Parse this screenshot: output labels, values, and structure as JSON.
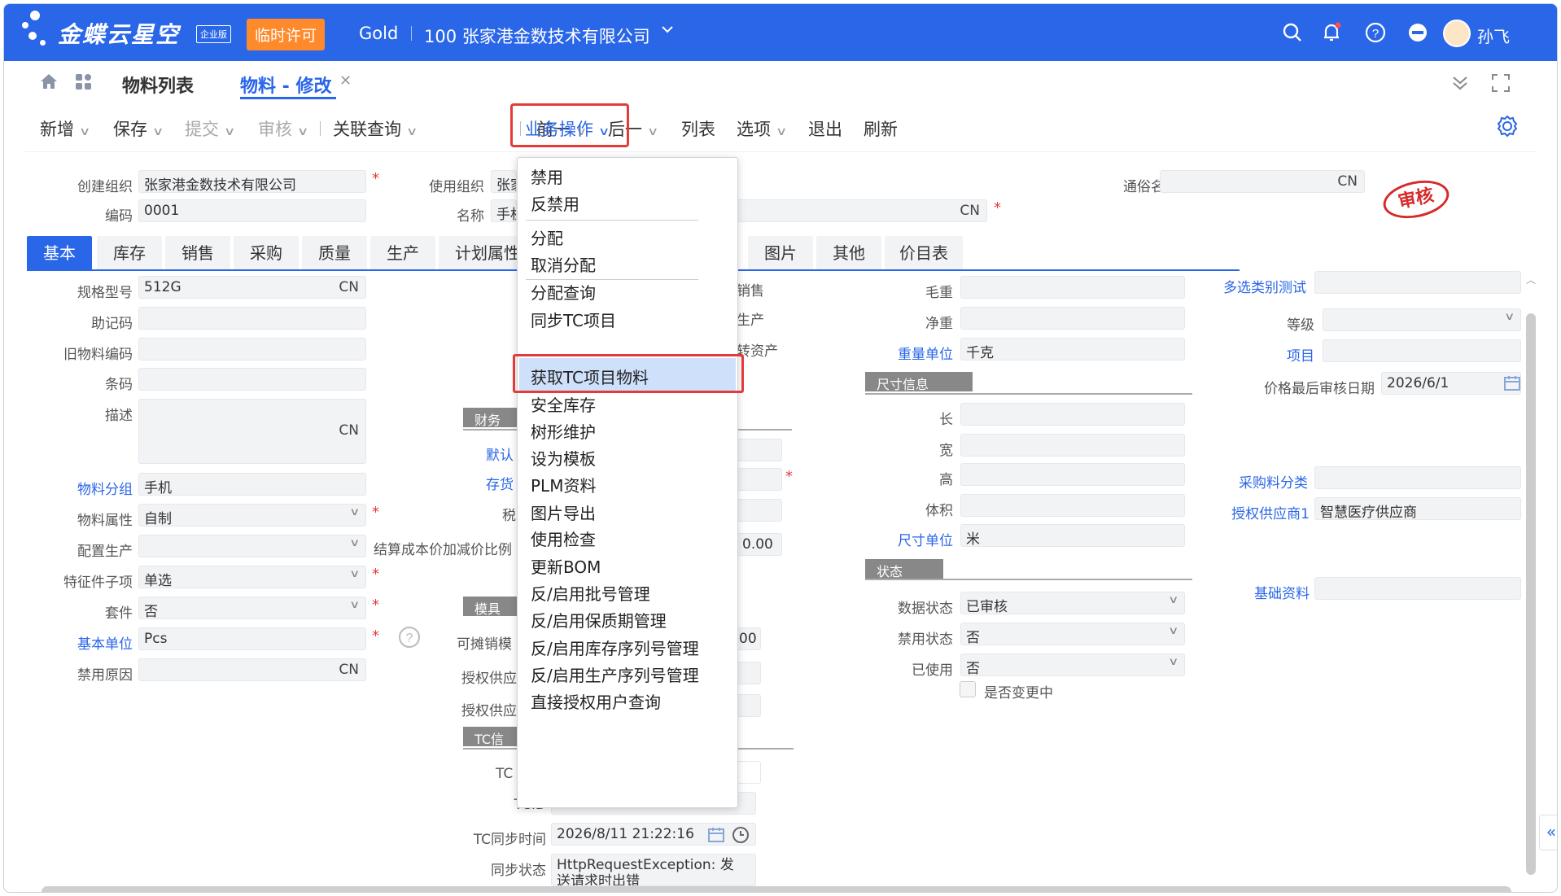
{
  "topbar": {
    "brand": "金蝶云星空",
    "edition": "企业版",
    "license": "临时许可",
    "tenant": "Gold",
    "company": "100 张家港金数技术有限公司",
    "user": "孙飞"
  },
  "tabs": {
    "list": "物料列表",
    "edit": "物料 - 修改"
  },
  "toolbar": {
    "new": "新增",
    "save": "保存",
    "submit": "提交",
    "audit": "审核",
    "related": "关联查询",
    "business": "业务操作",
    "prev": "前一",
    "next": "后一",
    "list": "列表",
    "options": "选项",
    "exit": "退出",
    "refresh": "刷新"
  },
  "header": {
    "create_org_label": "创建组织",
    "create_org": "张家港金数技术有限公司",
    "use_org_label": "使用组织",
    "use_org": "张家",
    "code_label": "编码",
    "code": "0001",
    "name_label": "名称",
    "name": "手机",
    "name_lang": "CN",
    "common_name_label": "通俗名",
    "common_name_lang": "CN",
    "stamp": "审核"
  },
  "form_tabs": [
    "基本",
    "库存",
    "销售",
    "采购",
    "质量",
    "生产",
    "计划属性",
    "图片",
    "其他",
    "价目表"
  ],
  "basic": {
    "spec_label": "规格型号",
    "spec": "512G",
    "spec_lang": "CN",
    "mnemonic_label": "助记码",
    "old_code_label": "旧物料编码",
    "barcode_label": "条码",
    "desc_label": "描述",
    "desc_lang": "CN",
    "group_label": "物料分组",
    "group": "手机",
    "attr_label": "物料属性",
    "attr": "自制",
    "config_label": "配置生产",
    "feature_label": "特征件子项",
    "feature": "单选",
    "kit_label": "套件",
    "kit": "否",
    "unit_label": "基本单位",
    "unit": "Pcs",
    "forbid_reason_label": "禁用原因",
    "forbid_reason_lang": "CN"
  },
  "middle": {
    "sale_text": "销售",
    "produce_text": "生产",
    "asset_text": "转资产",
    "finance_section": "财务",
    "default_label": "默认",
    "stock_label": "存货",
    "tax_label": "税",
    "cost_label": "结算成本价加减价比例",
    "cost_value": "0.00",
    "mold_section": "模具",
    "alloc_label": "可摊销模",
    "alloc_value": "00",
    "auth1_label": "授权供应",
    "auth2_label": "授权供应",
    "tc_section": "TC信",
    "tc_label": "TC",
    "tcid_label": "TCID",
    "tc_sync_time_label": "TC同步时间",
    "tc_sync_time": "2026/8/11 21:22:16",
    "sync_status_label": "同步状态",
    "sync_status": "HttpRequestException: 发送请求时出错"
  },
  "right": {
    "gross_label": "毛重",
    "net_label": "净重",
    "weight_unit_label": "重量单位",
    "weight_unit": "千克",
    "size_section": "尺寸信息",
    "length_label": "长",
    "width_label": "宽",
    "height_label": "高",
    "volume_label": "体积",
    "size_unit_label": "尺寸单位",
    "size_unit": "米",
    "status_section": "状态",
    "data_status_label": "数据状态",
    "data_status": "已审核",
    "forbid_status_label": "禁用状态",
    "forbid_status": "否",
    "used_label": "已使用",
    "used": "否",
    "changing_label": "是否变更中"
  },
  "far_right": {
    "multi_label": "多选类别测试",
    "grade_label": "等级",
    "project_label": "项目",
    "price_date_label": "价格最后审核日期",
    "price_date": "2026/6/1",
    "purchase_cat_label": "采购料分类",
    "auth_supplier_label": "授权供应商1",
    "auth_supplier": "智慧医疗供应商",
    "basic_data_label": "基础资料"
  },
  "menu": {
    "items": [
      "禁用",
      "反禁用",
      "分配",
      "取消分配",
      "分配查询",
      "同步TC项目",
      "获取TC项目物料",
      "安全库存",
      "树形维护",
      "设为模板",
      "PLM资料",
      "图片导出",
      "使用检查",
      "更新BOM",
      "反/启用批号管理",
      "反/启用保质期管理",
      "反/启用库存序列号管理",
      "反/启用生产序列号管理",
      "直接授权用户查询"
    ],
    "highlighted": "获取TC项目物料"
  },
  "colors": {
    "primary": "#2a66e8",
    "license": "#ff8a2b",
    "highlight": "#e43a3a"
  }
}
